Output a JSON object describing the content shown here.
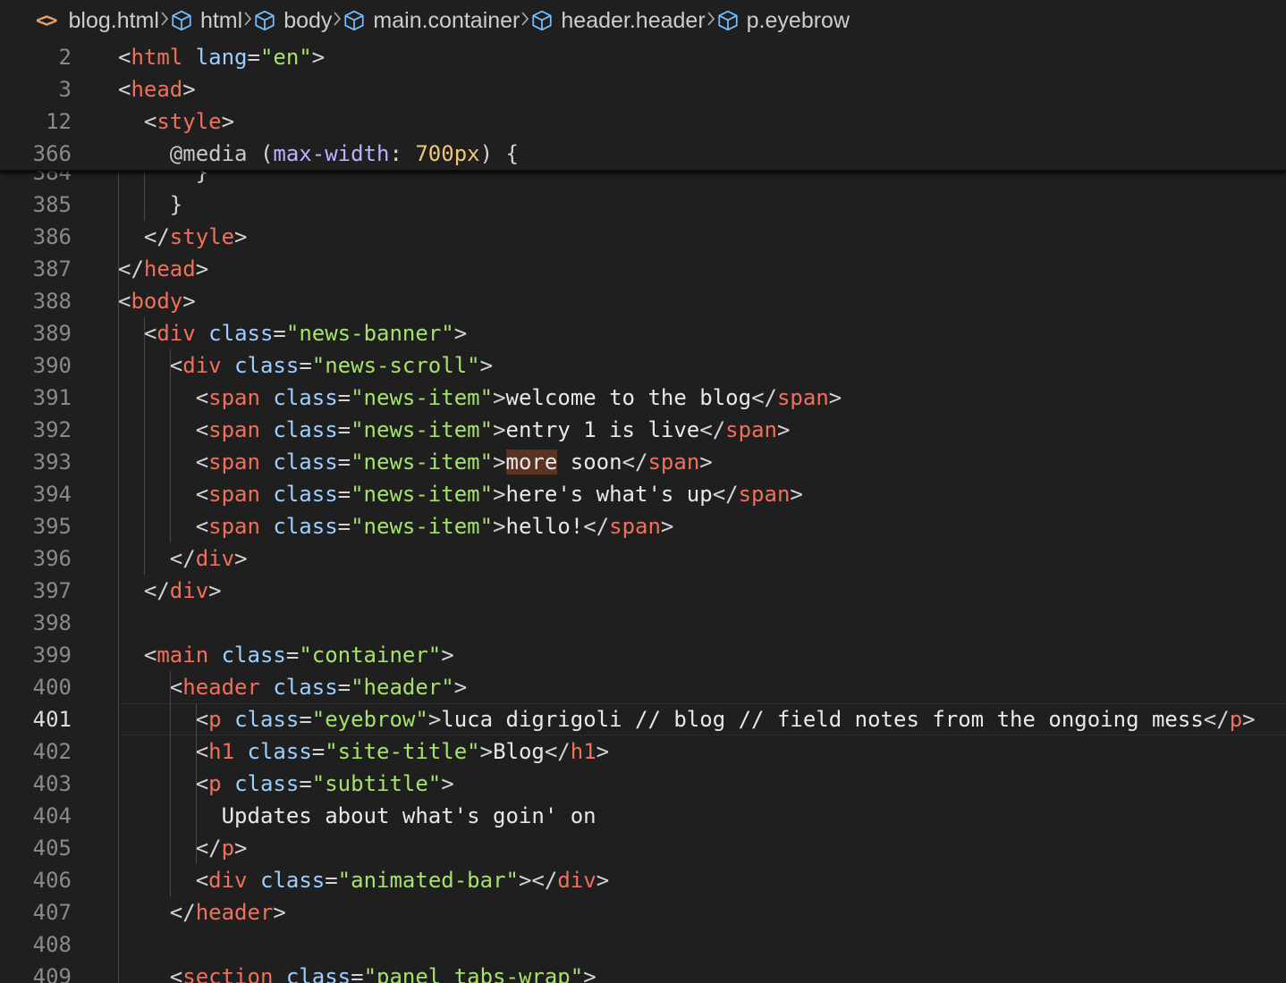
{
  "breadcrumb": [
    {
      "label": "blog.html",
      "icon": "code-file-icon"
    },
    {
      "label": "html",
      "icon": "cube-icon"
    },
    {
      "label": "body",
      "icon": "cube-icon"
    },
    {
      "label": "main.container",
      "icon": "cube-icon"
    },
    {
      "label": "header.header",
      "icon": "cube-icon"
    },
    {
      "label": "p.eyebrow",
      "icon": "cube-icon"
    }
  ],
  "sticky_lines": [
    {
      "num": "2",
      "tokens": [
        [
          "t-pun",
          "<"
        ],
        [
          "t-tag",
          "html"
        ],
        [
          "t-pun",
          " "
        ],
        [
          "t-attr",
          "lang"
        ],
        [
          "t-pun",
          "="
        ],
        [
          "t-str",
          "\"en\""
        ],
        [
          "t-pun",
          ">"
        ]
      ]
    },
    {
      "num": "3",
      "tokens": [
        [
          "t-pun",
          "<"
        ],
        [
          "t-tag",
          "head"
        ],
        [
          "t-pun",
          ">"
        ]
      ]
    },
    {
      "num": "12",
      "tokens": [
        [
          "t-pun",
          "  <"
        ],
        [
          "t-tag",
          "style"
        ],
        [
          "t-pun",
          ">"
        ]
      ]
    },
    {
      "num": "366",
      "tokens": [
        [
          "t-pun",
          "    "
        ],
        [
          "t-at",
          "@media"
        ],
        [
          "t-pun",
          " ("
        ],
        [
          "t-prop",
          "max-width"
        ],
        [
          "t-pun",
          ": "
        ],
        [
          "t-num",
          "700px"
        ],
        [
          "t-pun",
          ") {"
        ]
      ]
    }
  ],
  "partial_line": {
    "num": "384",
    "text": "      }"
  },
  "lines": [
    {
      "num": "385",
      "tokens": [
        [
          "t-pun",
          "    }"
        ]
      ]
    },
    {
      "num": "386",
      "tokens": [
        [
          "t-pun",
          "  </"
        ],
        [
          "t-tag",
          "style"
        ],
        [
          "t-pun",
          ">"
        ]
      ]
    },
    {
      "num": "387",
      "tokens": [
        [
          "t-pun",
          "</"
        ],
        [
          "t-tag",
          "head"
        ],
        [
          "t-pun",
          ">"
        ]
      ]
    },
    {
      "num": "388",
      "tokens": [
        [
          "t-pun",
          "<"
        ],
        [
          "t-tag",
          "body"
        ],
        [
          "t-pun",
          ">"
        ]
      ]
    },
    {
      "num": "389",
      "tokens": [
        [
          "t-pun",
          "  <"
        ],
        [
          "t-tag",
          "div"
        ],
        [
          "t-pun",
          " "
        ],
        [
          "t-attr",
          "class"
        ],
        [
          "t-pun",
          "="
        ],
        [
          "t-str",
          "\"news-banner\""
        ],
        [
          "t-pun",
          ">"
        ]
      ]
    },
    {
      "num": "390",
      "tokens": [
        [
          "t-pun",
          "    <"
        ],
        [
          "t-tag",
          "div"
        ],
        [
          "t-pun",
          " "
        ],
        [
          "t-attr",
          "class"
        ],
        [
          "t-pun",
          "="
        ],
        [
          "t-str",
          "\"news-scroll\""
        ],
        [
          "t-pun",
          ">"
        ]
      ]
    },
    {
      "num": "391",
      "tokens": [
        [
          "t-pun",
          "      <"
        ],
        [
          "t-tag",
          "span"
        ],
        [
          "t-pun",
          " "
        ],
        [
          "t-attr",
          "class"
        ],
        [
          "t-pun",
          "="
        ],
        [
          "t-str",
          "\"news-item\""
        ],
        [
          "t-pun",
          ">"
        ],
        [
          "t-txt",
          "welcome to the blog"
        ],
        [
          "t-pun",
          "</"
        ],
        [
          "t-tag",
          "span"
        ],
        [
          "t-pun",
          ">"
        ]
      ]
    },
    {
      "num": "392",
      "tokens": [
        [
          "t-pun",
          "      <"
        ],
        [
          "t-tag",
          "span"
        ],
        [
          "t-pun",
          " "
        ],
        [
          "t-attr",
          "class"
        ],
        [
          "t-pun",
          "="
        ],
        [
          "t-str",
          "\"news-item\""
        ],
        [
          "t-pun",
          ">"
        ],
        [
          "t-txt",
          "entry 1 is live"
        ],
        [
          "t-pun",
          "</"
        ],
        [
          "t-tag",
          "span"
        ],
        [
          "t-pun",
          ">"
        ]
      ]
    },
    {
      "num": "393",
      "tokens": [
        [
          "t-pun",
          "      <"
        ],
        [
          "t-tag",
          "span"
        ],
        [
          "t-pun",
          " "
        ],
        [
          "t-attr",
          "class"
        ],
        [
          "t-pun",
          "="
        ],
        [
          "t-str",
          "\"news-item\""
        ],
        [
          "t-pun",
          ">"
        ],
        [
          "t-txt hl",
          "more"
        ],
        [
          "t-txt",
          " soon"
        ],
        [
          "t-pun",
          "</"
        ],
        [
          "t-tag",
          "span"
        ],
        [
          "t-pun",
          ">"
        ]
      ]
    },
    {
      "num": "394",
      "tokens": [
        [
          "t-pun",
          "      <"
        ],
        [
          "t-tag",
          "span"
        ],
        [
          "t-pun",
          " "
        ],
        [
          "t-attr",
          "class"
        ],
        [
          "t-pun",
          "="
        ],
        [
          "t-str",
          "\"news-item\""
        ],
        [
          "t-pun",
          ">"
        ],
        [
          "t-txt",
          "here's what's up"
        ],
        [
          "t-pun",
          "</"
        ],
        [
          "t-tag",
          "span"
        ],
        [
          "t-pun",
          ">"
        ]
      ]
    },
    {
      "num": "395",
      "tokens": [
        [
          "t-pun",
          "      <"
        ],
        [
          "t-tag",
          "span"
        ],
        [
          "t-pun",
          " "
        ],
        [
          "t-attr",
          "class"
        ],
        [
          "t-pun",
          "="
        ],
        [
          "t-str",
          "\"news-item\""
        ],
        [
          "t-pun",
          ">"
        ],
        [
          "t-txt",
          "hello!"
        ],
        [
          "t-pun",
          "</"
        ],
        [
          "t-tag",
          "span"
        ],
        [
          "t-pun",
          ">"
        ]
      ]
    },
    {
      "num": "396",
      "tokens": [
        [
          "t-pun",
          "    </"
        ],
        [
          "t-tag",
          "div"
        ],
        [
          "t-pun",
          ">"
        ]
      ]
    },
    {
      "num": "397",
      "tokens": [
        [
          "t-pun",
          "  </"
        ],
        [
          "t-tag",
          "div"
        ],
        [
          "t-pun",
          ">"
        ]
      ]
    },
    {
      "num": "398",
      "tokens": []
    },
    {
      "num": "399",
      "tokens": [
        [
          "t-pun",
          "  <"
        ],
        [
          "t-tag",
          "main"
        ],
        [
          "t-pun",
          " "
        ],
        [
          "t-attr",
          "class"
        ],
        [
          "t-pun",
          "="
        ],
        [
          "t-str",
          "\"container\""
        ],
        [
          "t-pun",
          ">"
        ]
      ]
    },
    {
      "num": "400",
      "tokens": [
        [
          "t-pun",
          "    <"
        ],
        [
          "t-tag",
          "header"
        ],
        [
          "t-pun",
          " "
        ],
        [
          "t-attr",
          "class"
        ],
        [
          "t-pun",
          "="
        ],
        [
          "t-str",
          "\"header\""
        ],
        [
          "t-pun",
          ">"
        ]
      ]
    },
    {
      "num": "401",
      "active": true,
      "tokens": [
        [
          "t-pun",
          "      <"
        ],
        [
          "t-tag",
          "p"
        ],
        [
          "t-pun",
          " "
        ],
        [
          "t-attr",
          "class"
        ],
        [
          "t-pun",
          "="
        ],
        [
          "t-str",
          "\"eyebrow\""
        ],
        [
          "t-pun",
          ">"
        ],
        [
          "t-txt",
          "luca digrigoli // blog // field notes from the ongoing mess"
        ],
        [
          "t-pun",
          "</"
        ],
        [
          "t-tag",
          "p"
        ],
        [
          "t-pun",
          ">"
        ]
      ]
    },
    {
      "num": "402",
      "tokens": [
        [
          "t-pun",
          "      <"
        ],
        [
          "t-tag",
          "h1"
        ],
        [
          "t-pun",
          " "
        ],
        [
          "t-attr",
          "class"
        ],
        [
          "t-pun",
          "="
        ],
        [
          "t-str",
          "\"site-title\""
        ],
        [
          "t-pun",
          ">"
        ],
        [
          "t-txt",
          "Blog"
        ],
        [
          "t-pun",
          "</"
        ],
        [
          "t-tag",
          "h1"
        ],
        [
          "t-pun",
          ">"
        ]
      ]
    },
    {
      "num": "403",
      "tokens": [
        [
          "t-pun",
          "      <"
        ],
        [
          "t-tag",
          "p"
        ],
        [
          "t-pun",
          " "
        ],
        [
          "t-attr",
          "class"
        ],
        [
          "t-pun",
          "="
        ],
        [
          "t-str",
          "\"subtitle\""
        ],
        [
          "t-pun",
          ">"
        ]
      ]
    },
    {
      "num": "404",
      "tokens": [
        [
          "t-txt",
          "        Updates about what's goin' on"
        ]
      ]
    },
    {
      "num": "405",
      "tokens": [
        [
          "t-pun",
          "      </"
        ],
        [
          "t-tag",
          "p"
        ],
        [
          "t-pun",
          ">"
        ]
      ]
    },
    {
      "num": "406",
      "tokens": [
        [
          "t-pun",
          "      <"
        ],
        [
          "t-tag",
          "div"
        ],
        [
          "t-pun",
          " "
        ],
        [
          "t-attr",
          "class"
        ],
        [
          "t-pun",
          "="
        ],
        [
          "t-str",
          "\"animated-bar\""
        ],
        [
          "t-pun",
          "></"
        ],
        [
          "t-tag",
          "div"
        ],
        [
          "t-pun",
          ">"
        ]
      ]
    },
    {
      "num": "407",
      "tokens": [
        [
          "t-pun",
          "    </"
        ],
        [
          "t-tag",
          "header"
        ],
        [
          "t-pun",
          ">"
        ]
      ]
    },
    {
      "num": "408",
      "tokens": []
    },
    {
      "num": "409",
      "tokens": [
        [
          "t-pun",
          "    <"
        ],
        [
          "t-tag",
          "section"
        ],
        [
          "t-pun",
          " "
        ],
        [
          "t-attr",
          "class"
        ],
        [
          "t-pun",
          "="
        ],
        [
          "t-str",
          "\"panel tabs-wrap\""
        ],
        [
          "t-pun",
          ">"
        ]
      ]
    }
  ]
}
